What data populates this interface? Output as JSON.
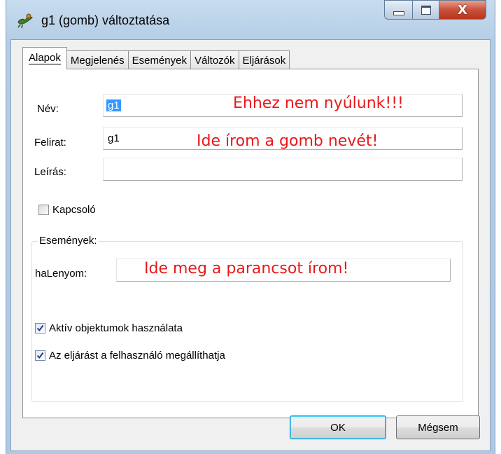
{
  "window": {
    "title": "g1 (gomb) változtatása",
    "close_glyph": "X"
  },
  "tabs": [
    {
      "label": "Alapok",
      "active": true
    },
    {
      "label": "Megjelenés",
      "active": false
    },
    {
      "label": "Események",
      "active": false
    },
    {
      "label": "Változók",
      "active": false
    },
    {
      "label": "Eljárások",
      "active": false
    }
  ],
  "form": {
    "name_label": "Név:",
    "name_value": "g1",
    "name_note": "Ehhez nem nyúlunk!!!",
    "caption_label": "Felirat:",
    "caption_value": "g1",
    "caption_note": "Ide írom a gomb nevét!",
    "description_label": "Leírás:",
    "description_value": "",
    "toggle_label": "Kapcsoló",
    "toggle_checked": false
  },
  "events": {
    "legend": "Események:",
    "onpress_label": "haLenyom:",
    "onpress_value": "",
    "onpress_note": "Ide meg a parancsot írom!",
    "active_objects_label": "Aktív objektumok használata",
    "active_objects_checked": true,
    "user_stoppable_label": "Az eljárást a felhasználó megállíthatja",
    "user_stoppable_checked": true
  },
  "buttons": {
    "ok": "OK",
    "cancel": "Mégsem"
  },
  "colors": {
    "annotation": "#e8191b",
    "selection": "#3399ff"
  }
}
